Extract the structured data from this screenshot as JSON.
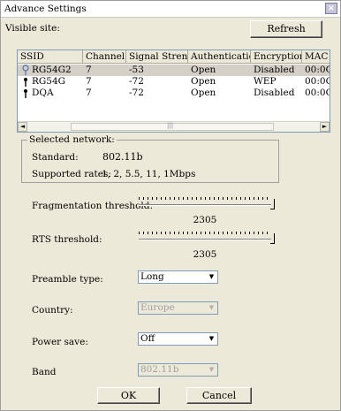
{
  "window": {
    "title": "Advance Settings",
    "close_glyph": "×"
  },
  "site_label": "Visible site:",
  "refresh_label": "Refresh",
  "table": {
    "columns": [
      "SSID",
      "Channel",
      "Signal Stren...",
      "Authentication",
      "Encryption",
      "MAC"
    ],
    "rows": [
      {
        "icon": "signal-icon",
        "ssid": "RG54G2",
        "channel": "7",
        "signal": "-53",
        "auth": "Open",
        "enc": "Disabled",
        "mac": "00:0C"
      },
      {
        "icon": "signal-icon",
        "ssid": "RG54G",
        "channel": "7",
        "signal": "-72",
        "auth": "Open",
        "enc": "WEP",
        "mac": "00:0C"
      },
      {
        "icon": "signal-icon",
        "ssid": "DQA",
        "channel": "7",
        "signal": "-72",
        "auth": "Open",
        "enc": "Disabled",
        "mac": "00:0C"
      }
    ],
    "scroll_left": "◄",
    "scroll_right": "►",
    "scroll_grip": "|||"
  },
  "selected_network": {
    "title": "Selected network:",
    "standard_label": "Standard:",
    "standard_value": "802.11b",
    "rates_label": "Supported rates:",
    "rates_value": "1, 2, 5.5, 11, 1Mbps"
  },
  "frag": {
    "label": "Fragmentation threshold:",
    "value": "2305"
  },
  "rts": {
    "label": "RTS threshold:",
    "value": "2305"
  },
  "preamble": {
    "label": "Preamble type:",
    "value": "Long"
  },
  "country": {
    "label": "Country:",
    "value": "Europe"
  },
  "power": {
    "label": "Power save:",
    "value": "Off"
  },
  "band": {
    "label": "Band",
    "value": "802.11b"
  },
  "combo_arrow": "▼",
  "ok_label": "OK",
  "cancel_label": "Cancel"
}
